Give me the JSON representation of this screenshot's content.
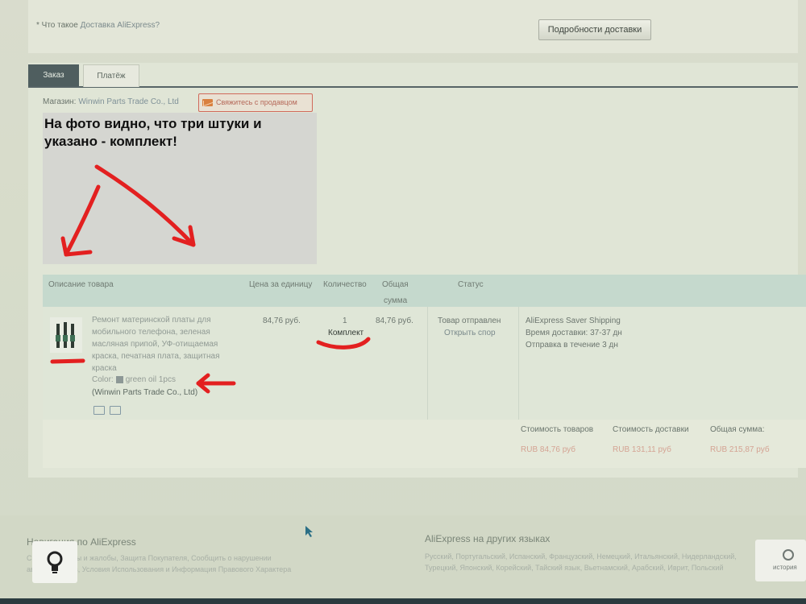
{
  "shipping": {
    "note_prefix": "* Что такое",
    "note_link": "Доставка AliExpress?",
    "details_button": "Подробности доставки"
  },
  "tabs": [
    {
      "label": "Заказ"
    },
    {
      "label": "Платёж"
    }
  ],
  "store": {
    "label": "Магазин:",
    "name": "Winwin Parts Trade Co., Ltd",
    "contact_button": "Свяжитесь с продавцом"
  },
  "annotation": {
    "text": "На фото видно, что три штуки и указано - комплект!"
  },
  "table": {
    "headers": {
      "description": "Описание товара",
      "unit_price": "Цена за единицу",
      "quantity": "Количество",
      "total_line1": "Общая",
      "total_line2": "сумма",
      "status": "Статус"
    },
    "row": {
      "title": "Ремонт материнской платы для мобильного телефона, зеленая масляная припой, УФ-отищаемая краска, печатная плата, защитная краска",
      "color_label": "Color:",
      "color_value": "green oil 1pcs",
      "seller": "(Winwin Parts Trade Co., Ltd)",
      "unit_price": "84,76 руб.",
      "quantity": "1",
      "unit": "Комплект",
      "total": "84,76 руб.",
      "status": "Товар отправлен",
      "dispute": "Открыть спор",
      "shipping_method": "AliExpress Saver Shipping",
      "delivery_time": "Время доставки: 37-37 дн",
      "dispatch_time": "Отправка в течение 3 дн"
    },
    "summary": {
      "goods_label": "Стоимость товаров",
      "goods_value": "RUB 84,76 руб",
      "shipping_label": "Стоимость доставки",
      "shipping_value": "RUB 131,11 руб",
      "total_label": "Общая сумма:",
      "total_value": "RUB 215,87 руб"
    }
  },
  "footer": {
    "nav_title": "Навигация по AliExpress",
    "nav_line1": "Справка, Споры и жалобы, Защита Покупателя, Сообщить о нарушении",
    "nav_line2": "авторских прав, Условия Использования и Информация Правового Характера",
    "lang_title": "AliExpress на других языках",
    "lang_line1": "Русский, Португальский, Испанский, Французский, Немецкий, Итальянский, Нидерландский,",
    "lang_line2": "Турецкий, Японский, Корейский, Тайский язык, Вьетнамский, Арабский, Иврит, Польский",
    "history_label": "история"
  },
  "colors": {
    "ink_red": "#e32020",
    "tab_active": "#4f5e5f",
    "table_header": "#c5d9cd",
    "price_red": "#d4a393"
  }
}
